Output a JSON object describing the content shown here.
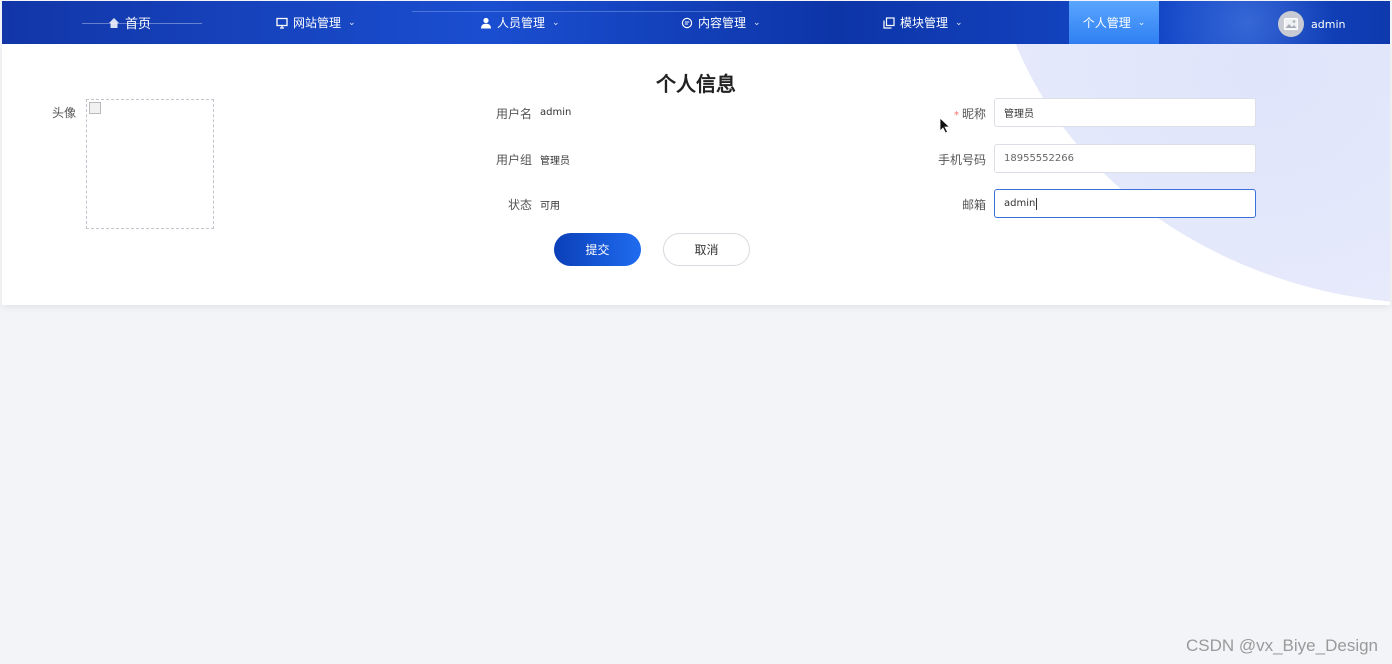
{
  "nav": {
    "home": "首页",
    "site": "网站管理",
    "staff": "人员管理",
    "content": "内容管理",
    "module": "模块管理",
    "personal": "个人管理",
    "username": "admin"
  },
  "form": {
    "title": "个人信息",
    "avatar_label": "头像",
    "username_label": "用户名",
    "username_value": "admin",
    "group_label": "用户组",
    "group_value": "管理员",
    "status_label": "状态",
    "status_value": "可用",
    "required_mark": "*",
    "nickname_label": "昵称",
    "nickname_value": "管理员",
    "phone_label": "手机号码",
    "phone_value": "18955552266",
    "email_label": "邮箱",
    "email_value": "admin"
  },
  "buttons": {
    "submit": "提交",
    "cancel": "取消"
  },
  "watermark": "CSDN @vx_Biye_Design",
  "colors": {
    "nav_bg": "#1a4ed0",
    "nav_active": "#3f8cf7",
    "submit_bg": "#1352d8",
    "required": "#f56c6c"
  }
}
